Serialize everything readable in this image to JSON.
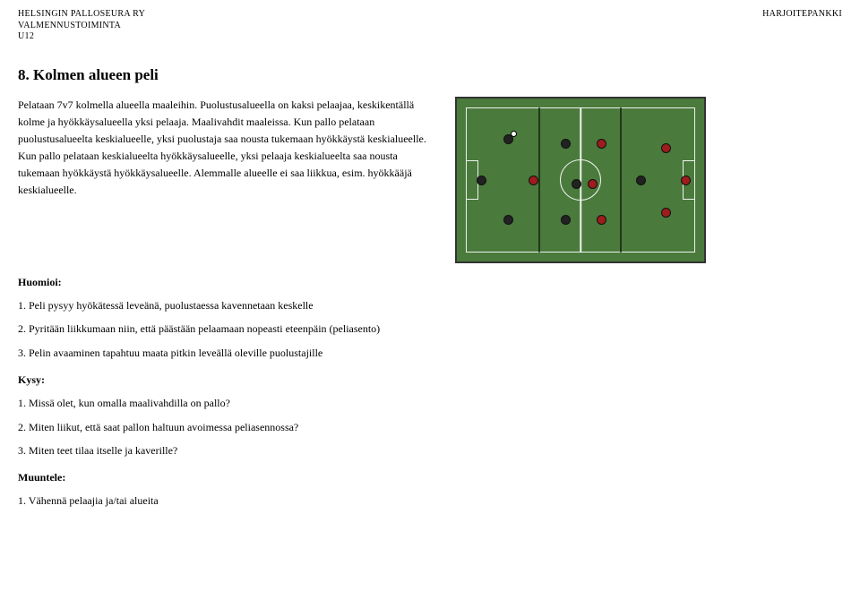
{
  "header": {
    "org": "HELSINGIN PALLOSEURA RY",
    "dept": "VALMENNUSTOIMINTA",
    "age": "U12",
    "right": "HARJOITEPANKKI"
  },
  "title": "8. Kolmen alueen peli",
  "intro": "Pelataan 7v7 kolmella alueella maaleihin. Puolustusalueella on kaksi pelaajaa, keskikentällä kolme ja hyökkäysalueella yksi pelaaja. Maalivahdit maaleissa. Kun pallo pelataan puolustusalueelta keskialueelle, yksi puolustaja saa nousta tukemaan hyökkäystä keskialueelle. Kun pallo pelataan keskialueelta hyökkäysalueelle, yksi pelaaja keskialueelta saa nousta tukemaan hyökkäystä hyökkäysalueelle. Alemmalle alueelle ei saa liikkua, esim. hyökkääjä keskialueelle.",
  "sections": {
    "huomioi": "Huomioi:",
    "kysy": "Kysy:",
    "muuntele": "Muuntele:"
  },
  "huomioi": [
    "1. Peli pysyy hyökätessä leveänä, puolustaessa kavennetaan keskelle",
    "2. Pyritään liikkumaan niin, että päästään pelaamaan nopeasti eteenpäin (peliasento)",
    "3. Pelin avaaminen tapahtuu maata pitkin leveällä oleville puolustajille"
  ],
  "kysy": [
    "1. Missä olet, kun omalla maalivahdilla on pallo?",
    "2. Miten liikut, että saat pallon haltuun avoimessa peliasennossa?",
    "3. Miten teet tilaa itselle ja kaverille?"
  ],
  "muuntele": [
    "1. Vähennä pelaajia ja/tai alueita"
  ]
}
